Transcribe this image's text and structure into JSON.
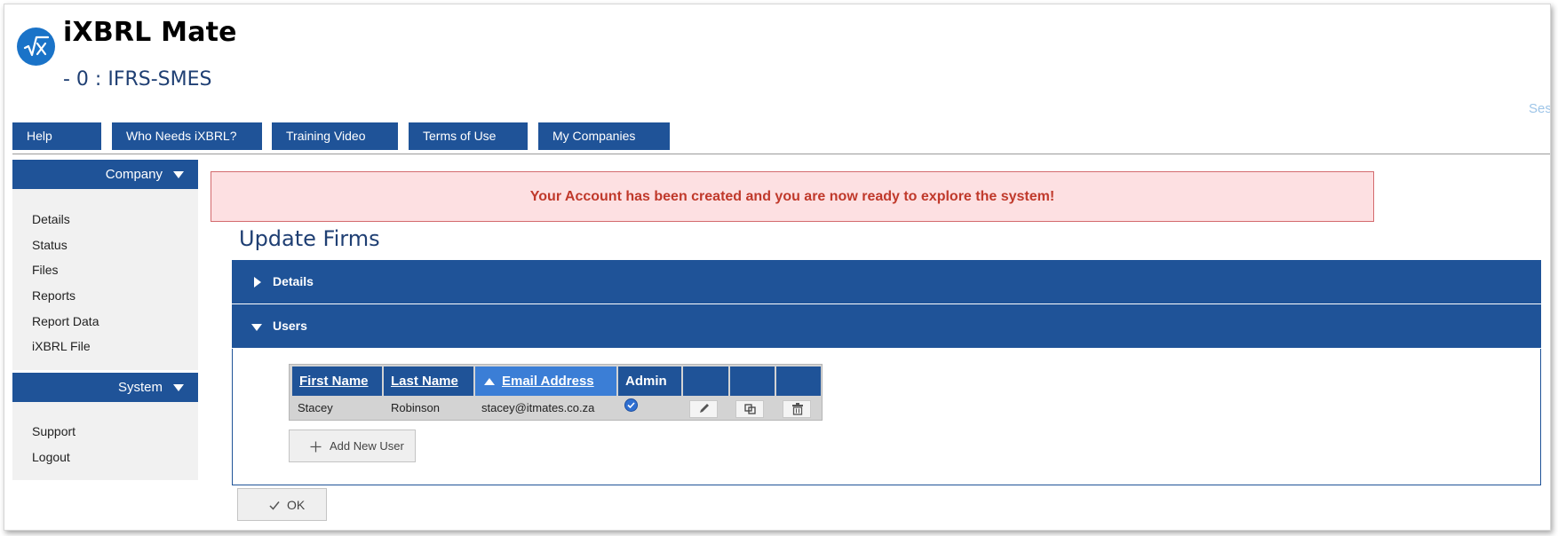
{
  "header": {
    "app_title": "iXBRL Mate",
    "subtitle": "- 0 : IFRS-SMES",
    "session_text": "Ses"
  },
  "top_nav": {
    "items": [
      {
        "label": "Help"
      },
      {
        "label": "Who Needs iXBRL?"
      },
      {
        "label": "Training Video"
      },
      {
        "label": "Terms of Use"
      },
      {
        "label": "My Companies"
      }
    ]
  },
  "sidebar": {
    "company": {
      "label": "Company",
      "items": [
        {
          "label": "Details"
        },
        {
          "label": "Status"
        },
        {
          "label": "Files"
        },
        {
          "label": "Reports"
        },
        {
          "label": "Report Data"
        },
        {
          "label": "iXBRL File"
        }
      ]
    },
    "system": {
      "label": "System",
      "items": [
        {
          "label": "Support"
        },
        {
          "label": "Logout"
        }
      ]
    }
  },
  "alert": {
    "message": "Your Account has been created and you are now ready to explore the system!"
  },
  "main": {
    "page_title": "Update Firms",
    "sections": [
      {
        "label": "Details",
        "expanded": false
      },
      {
        "label": "Users",
        "expanded": true
      }
    ],
    "users_table": {
      "columns": [
        {
          "label": "First Name"
        },
        {
          "label": "Last Name"
        },
        {
          "label": "Email Address",
          "sort": "ascending"
        },
        {
          "label": "Admin"
        },
        {
          "label": ""
        },
        {
          "label": ""
        },
        {
          "label": ""
        }
      ],
      "rows": [
        {
          "first_name": "Stacey",
          "last_name": "Robinson",
          "email": "stacey@itmates.co.za",
          "admin": true
        }
      ]
    },
    "add_user_label": "Add New User",
    "ok_label": "OK"
  },
  "colors": {
    "nav_blue": "#1f5398",
    "sorted_header": "#3b7ed6",
    "alert_bg": "#fde0e2",
    "alert_text": "#c0392b",
    "title_blue": "#1f3f73"
  },
  "icons": [
    "sqrt-x-logo-icon",
    "chevron-down-icon",
    "caret-right-icon",
    "sort-ascending-icon",
    "check-circle-icon",
    "pencil-icon",
    "copy-icon",
    "trash-icon",
    "plus-icon",
    "checkmark-icon"
  ]
}
